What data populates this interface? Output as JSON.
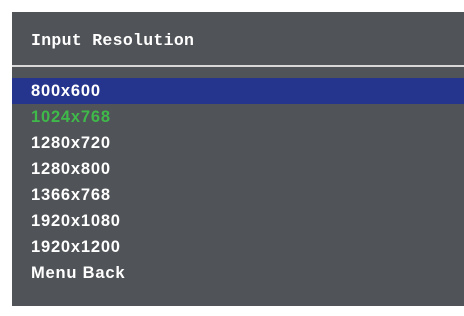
{
  "menu": {
    "title": "Input Resolution",
    "items": [
      {
        "label": "800x600",
        "state": "highlighted"
      },
      {
        "label": "1024x768",
        "state": "current"
      },
      {
        "label": "1280x720",
        "state": "normal"
      },
      {
        "label": "1280x800",
        "state": "normal"
      },
      {
        "label": "1366x768",
        "state": "normal"
      },
      {
        "label": "1920x1080",
        "state": "normal"
      },
      {
        "label": "1920x1200",
        "state": "normal"
      },
      {
        "label": "Menu Back",
        "state": "normal"
      }
    ]
  },
  "colors": {
    "panel_background": "#505357",
    "highlight_bar": "#25358e",
    "current_value_text": "#3fb94a",
    "text": "#ffffff",
    "divider": "#d8d8d8"
  }
}
